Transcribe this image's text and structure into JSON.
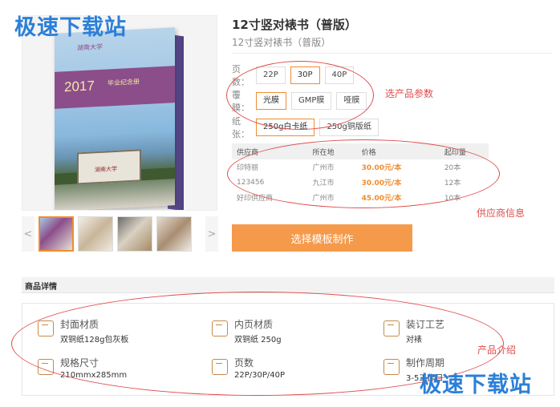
{
  "watermarks": {
    "top": "极速下载站",
    "bottom": "极速下载站"
  },
  "product": {
    "title": "12寸竖对裱书（普版）",
    "subtitle": "12寸竖对裱书（普版）",
    "cover": {
      "logo": "湖南大学",
      "year": "2017",
      "sub_title": "毕业纪念册",
      "building_text": "湖南大学"
    },
    "thumbnails": [
      "thumb-1",
      "thumb-2",
      "thumb-3",
      "thumb-4"
    ],
    "nav": {
      "prev": "<",
      "next": ">"
    }
  },
  "params": {
    "pages": {
      "label": "页数：",
      "options": [
        "22P",
        "30P",
        "40P"
      ],
      "selected": "30P"
    },
    "film": {
      "label": "覆膜：",
      "options": [
        "光膜",
        "GMP膜",
        "哑膜"
      ],
      "selected": "光膜"
    },
    "paper": {
      "label": "纸张：",
      "options": [
        "250g白卡纸",
        "250g铜版纸"
      ],
      "selected": "250g白卡纸"
    }
  },
  "supplier_table": {
    "headers": [
      "供应商",
      "所在地",
      "价格",
      "起印量"
    ],
    "rows": [
      [
        "印特丽",
        "广州市",
        "30.00元/本",
        "20本"
      ],
      [
        "123456",
        "九江市",
        "30.00元/本",
        "12本"
      ],
      [
        "好印供应商",
        "广州市",
        "45.00元/本",
        "10本"
      ]
    ]
  },
  "cta_label": "选择模板制作",
  "annotations": {
    "params": "选产品参数",
    "supplier": "供应商信息",
    "intro": "产品介绍"
  },
  "details": {
    "title": "商品详情",
    "specs": [
      {
        "name": "封面材质",
        "value": "双铜纸128g包灰板",
        "icon": "book-icon"
      },
      {
        "name": "内页材质",
        "value": "双铜纸 250g",
        "icon": "open-book-icon"
      },
      {
        "name": "装订工艺",
        "value": "对裱",
        "icon": "binding-icon"
      },
      {
        "name": "规格尺寸",
        "value": "210mmx285mm",
        "icon": "ruler-icon"
      },
      {
        "name": "页数",
        "value": "22P/30P/40P",
        "icon": "pages-icon"
      },
      {
        "name": "制作周期",
        "value": "3-5工作日",
        "icon": "truck-icon"
      }
    ]
  },
  "colors": {
    "accent": "#f08c2e",
    "cta": "#f59a4a",
    "annotation": "#e04c4c",
    "watermark": "#2b7fd8"
  }
}
